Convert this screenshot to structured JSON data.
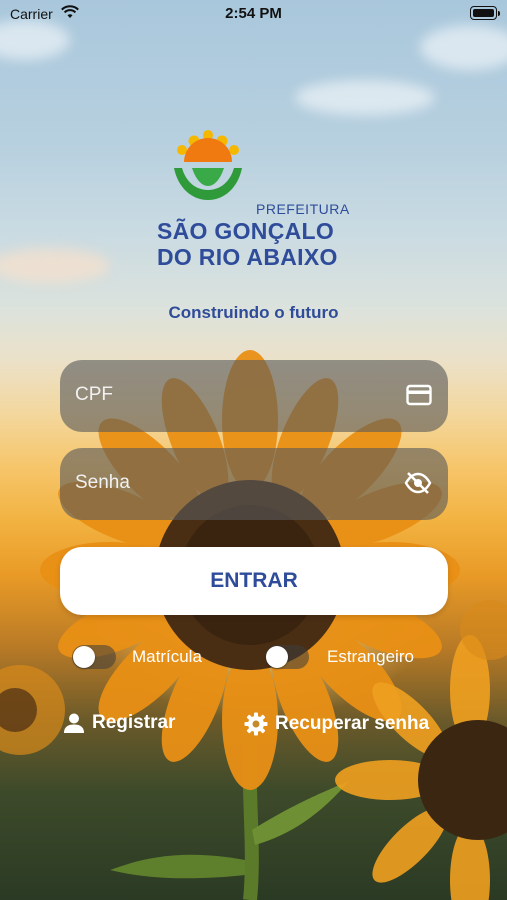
{
  "status_bar": {
    "carrier": "Carrier",
    "time": "2:54 PM"
  },
  "brand": {
    "prefeitura": "PREFEITURA",
    "city_line1": "SÃO GONÇALO",
    "city_line2": "DO RIO ABAIXO",
    "tagline": "Construindo o futuro"
  },
  "form": {
    "cpf_placeholder": "CPF",
    "senha_placeholder": "Senha",
    "submit_label": "ENTRAR"
  },
  "toggles": [
    {
      "label": "Matrícula",
      "on": false
    },
    {
      "label": "Estrangeiro",
      "on": false
    }
  ],
  "links": {
    "register": "Registrar",
    "recover": "Recuperar senha"
  },
  "colors": {
    "brand_blue": "#2f4c9a",
    "field_bg": "#5a5a5a",
    "white": "#ffffff"
  },
  "icons": [
    "wifi-icon",
    "battery-icon",
    "card-icon",
    "eye-off-icon",
    "user-icon",
    "gear-icon"
  ]
}
